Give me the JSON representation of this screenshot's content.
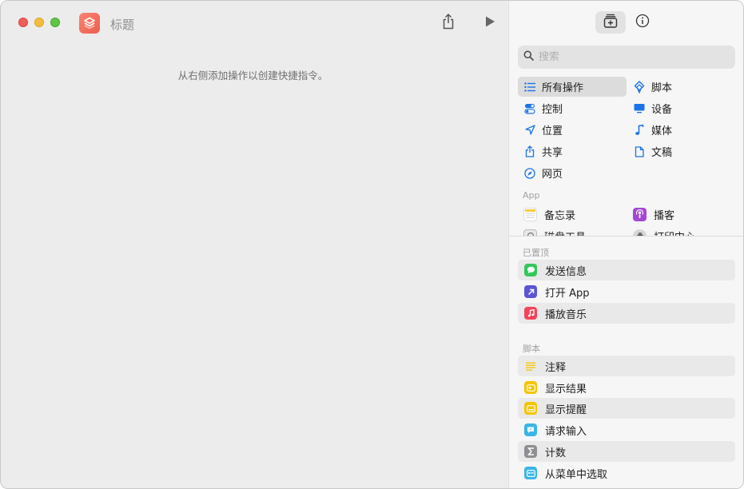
{
  "window": {
    "title": "标题"
  },
  "editor": {
    "hint": "从右侧添加操作以创建快捷指令。"
  },
  "sidebar": {
    "search": {
      "placeholder": "搜索",
      "value": ""
    },
    "categories": [
      {
        "label": "所有操作",
        "icon": "list-icon",
        "selected": true
      },
      {
        "label": "脚本",
        "icon": "script-icon"
      },
      {
        "label": "控制",
        "icon": "toggle-icon"
      },
      {
        "label": "设备",
        "icon": "display-icon"
      },
      {
        "label": "位置",
        "icon": "location-arrow-icon"
      },
      {
        "label": "媒体",
        "icon": "music-note-icon"
      },
      {
        "label": "共享",
        "icon": "share-icon"
      },
      {
        "label": "文稿",
        "icon": "document-icon"
      },
      {
        "label": "网页",
        "icon": "compass-icon"
      }
    ],
    "app_section": {
      "label": "App",
      "items": [
        {
          "label": "备忘录",
          "icon": "notes-app-icon"
        },
        {
          "label": "播客",
          "icon": "podcasts-app-icon"
        },
        {
          "label": "磁盘工具",
          "icon": "disk-utility-app-icon"
        },
        {
          "label": "打印中心",
          "icon": "print-center-app-icon"
        }
      ]
    },
    "pinned_section": {
      "label": "已置顶",
      "items": [
        {
          "label": "发送信息",
          "icon": "messages-icon"
        },
        {
          "label": "打开 App",
          "icon": "open-app-icon"
        },
        {
          "label": "播放音乐",
          "icon": "music-icon"
        }
      ]
    },
    "scripting_section": {
      "label": "脚本",
      "items": [
        {
          "label": "注释",
          "icon": "comment-lines-icon"
        },
        {
          "label": "显示结果",
          "icon": "show-result-icon"
        },
        {
          "label": "显示提醒",
          "icon": "show-alert-icon"
        },
        {
          "label": "请求输入",
          "icon": "ask-input-icon"
        },
        {
          "label": "计数",
          "icon": "sigma-icon"
        },
        {
          "label": "从菜单中选取",
          "icon": "choose-menu-icon"
        }
      ]
    }
  },
  "colors": {
    "accent_blue": "#1a73e8",
    "shortcuts_icon": "#ee6b58",
    "messages_green": "#34c759",
    "open_app_indigo": "#5b55d6",
    "music_red": "#f2445a",
    "script_yellow": "#f5c400",
    "ask_input_cyan": "#3ab5e6",
    "sigma_gray": "#8e8e93"
  }
}
